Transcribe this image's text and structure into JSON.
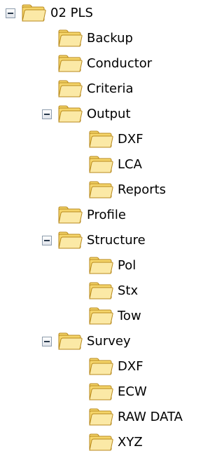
{
  "tree": {
    "nodes": [
      {
        "label": "02 PLS",
        "level": 0,
        "expander": "minus"
      },
      {
        "label": "Backup",
        "level": 1,
        "expander": ""
      },
      {
        "label": "Conductor",
        "level": 1,
        "expander": ""
      },
      {
        "label": "Criteria",
        "level": 1,
        "expander": ""
      },
      {
        "label": "Output",
        "level": 1,
        "expander": "minus"
      },
      {
        "label": "DXF",
        "level": 2,
        "expander": ""
      },
      {
        "label": "LCA",
        "level": 2,
        "expander": ""
      },
      {
        "label": "Reports",
        "level": 2,
        "expander": ""
      },
      {
        "label": "Profile",
        "level": 1,
        "expander": ""
      },
      {
        "label": "Structure",
        "level": 1,
        "expander": "minus"
      },
      {
        "label": "Pol",
        "level": 2,
        "expander": ""
      },
      {
        "label": "Stx",
        "level": 2,
        "expander": ""
      },
      {
        "label": "Tow",
        "level": 2,
        "expander": ""
      },
      {
        "label": "Survey",
        "level": 1,
        "expander": "minus"
      },
      {
        "label": "DXF",
        "level": 2,
        "expander": ""
      },
      {
        "label": "ECW",
        "level": 2,
        "expander": ""
      },
      {
        "label": "RAW DATA",
        "level": 2,
        "expander": ""
      },
      {
        "label": "XYZ",
        "level": 2,
        "expander": ""
      }
    ]
  },
  "icons": {
    "folder": "folder-icon",
    "expander": "collapse-minus-icon"
  },
  "colors": {
    "folder_fill": "#f5d56a",
    "folder_light": "#fbe9a6",
    "folder_stroke": "#b8891c",
    "expander_border": "#8c9bab"
  }
}
